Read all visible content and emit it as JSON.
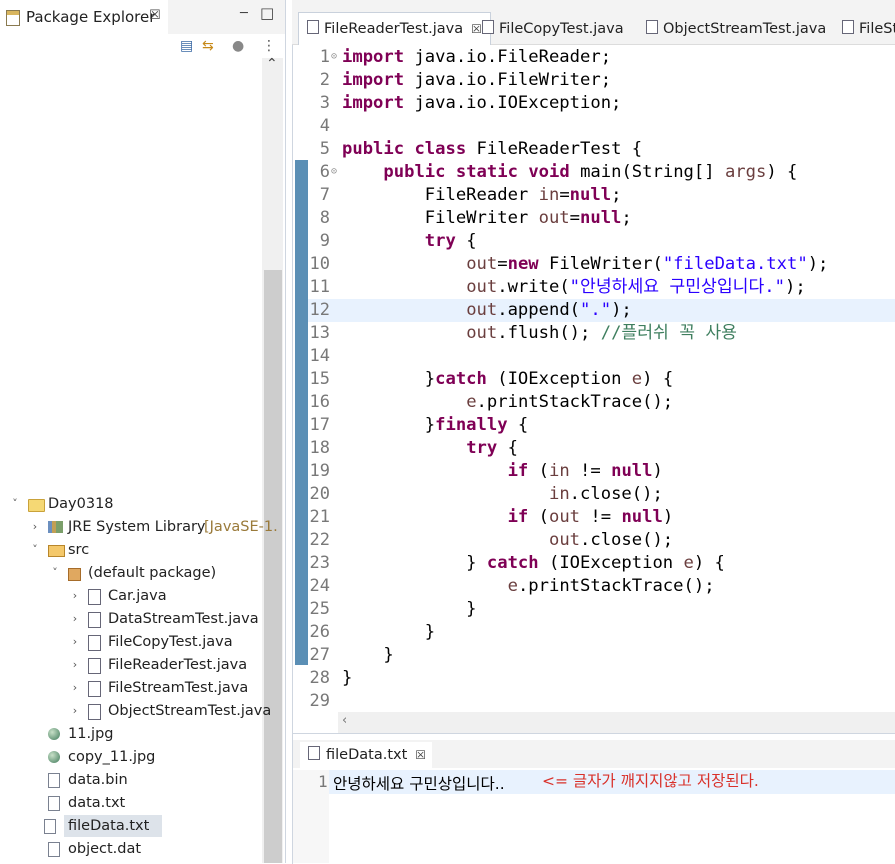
{
  "explorer": {
    "title": "Package Explorer",
    "close": "☒",
    "tree": [
      {
        "label": "Day0318",
        "icon": "project",
        "indent": 0,
        "twisty": "˅"
      },
      {
        "label": "JRE System Library",
        "suffix": "[JavaSE-1.",
        "icon": "library",
        "indent": 1,
        "twisty": "›"
      },
      {
        "label": "src",
        "icon": "source-folder",
        "indent": 1,
        "twisty": "˅"
      },
      {
        "label": "(default package)",
        "icon": "package",
        "indent": 2,
        "twisty": "˅"
      },
      {
        "label": "Car.java",
        "icon": "java",
        "indent": 3,
        "twisty": "›"
      },
      {
        "label": "DataStreamTest.java",
        "icon": "java",
        "indent": 3,
        "twisty": "›"
      },
      {
        "label": "FileCopyTest.java",
        "icon": "java",
        "indent": 3,
        "twisty": "›"
      },
      {
        "label": "FileReaderTest.java",
        "icon": "java",
        "indent": 3,
        "twisty": "›"
      },
      {
        "label": "FileStreamTest.java",
        "icon": "java",
        "indent": 3,
        "twisty": "›"
      },
      {
        "label": "ObjectStreamTest.java",
        "icon": "java",
        "indent": 3,
        "twisty": "›"
      },
      {
        "label": "11.jpg",
        "icon": "image",
        "indent": 1,
        "twisty": ""
      },
      {
        "label": "copy_11.jpg",
        "icon": "image",
        "indent": 1,
        "twisty": ""
      },
      {
        "label": "data.bin",
        "icon": "file",
        "indent": 1,
        "twisty": ""
      },
      {
        "label": "data.txt",
        "icon": "file",
        "indent": 1,
        "twisty": ""
      },
      {
        "label": "fileData.txt",
        "icon": "file",
        "indent": 1,
        "twisty": "",
        "selected": true
      },
      {
        "label": "object.dat",
        "icon": "file",
        "indent": 1,
        "twisty": ""
      }
    ]
  },
  "editor": {
    "tabs": [
      {
        "label": "FileReaderTest.java",
        "active": true,
        "close": "☒"
      },
      {
        "label": "FileCopyTest.java"
      },
      {
        "label": "ObjectStreamTest.java"
      },
      {
        "label": "FileStr"
      }
    ],
    "lines": [
      {
        "n": "1",
        "fold": "⊝",
        "t": [
          [
            "import",
            "kw"
          ],
          [
            " java.io.FileReader;",
            ""
          ]
        ]
      },
      {
        "n": "2",
        "t": [
          [
            "import",
            "kw"
          ],
          [
            " java.io.FileWriter;",
            ""
          ]
        ]
      },
      {
        "n": "3",
        "t": [
          [
            "import",
            "kw"
          ],
          [
            " java.io.IOException;",
            ""
          ]
        ]
      },
      {
        "n": "4",
        "t": []
      },
      {
        "n": "5",
        "t": [
          [
            "public",
            "kw"
          ],
          [
            " ",
            ""
          ],
          [
            "class",
            "kw"
          ],
          [
            " FileReaderTest {",
            ""
          ]
        ]
      },
      {
        "n": "6",
        "fold": "⊝",
        "t": [
          [
            "    ",
            ""
          ],
          [
            "public",
            "kw"
          ],
          [
            " ",
            ""
          ],
          [
            "static",
            "kw"
          ],
          [
            " ",
            ""
          ],
          [
            "void",
            "kw"
          ],
          [
            " main(String[] ",
            ""
          ],
          [
            "args",
            "var"
          ],
          [
            ") {",
            ""
          ]
        ]
      },
      {
        "n": "7",
        "t": [
          [
            "        FileReader ",
            ""
          ],
          [
            "in",
            "var"
          ],
          [
            "=",
            ""
          ],
          [
            "null",
            "kw"
          ],
          [
            ";",
            ""
          ]
        ]
      },
      {
        "n": "8",
        "t": [
          [
            "        FileWriter ",
            ""
          ],
          [
            "out",
            "var"
          ],
          [
            "=",
            ""
          ],
          [
            "null",
            "kw"
          ],
          [
            ";",
            ""
          ]
        ]
      },
      {
        "n": "9",
        "t": [
          [
            "        ",
            ""
          ],
          [
            "try",
            "kw"
          ],
          [
            " {",
            ""
          ]
        ]
      },
      {
        "n": "10",
        "t": [
          [
            "            ",
            ""
          ],
          [
            "out",
            "var"
          ],
          [
            "=",
            ""
          ],
          [
            "new",
            "kw"
          ],
          [
            " FileWriter(",
            ""
          ],
          [
            "\"fileData.txt\"",
            "str"
          ],
          [
            ");",
            ""
          ]
        ]
      },
      {
        "n": "11",
        "t": [
          [
            "            ",
            ""
          ],
          [
            "out",
            "var"
          ],
          [
            ".write(",
            ""
          ],
          [
            "\"안녕하세요 구민상입니다.\"",
            "str"
          ],
          [
            ");",
            ""
          ]
        ]
      },
      {
        "n": "12",
        "current": true,
        "t": [
          [
            "            ",
            ""
          ],
          [
            "out",
            "var"
          ],
          [
            ".append(",
            ""
          ],
          [
            "\".\"",
            "str"
          ],
          [
            ");",
            ""
          ]
        ]
      },
      {
        "n": "13",
        "t": [
          [
            "            ",
            ""
          ],
          [
            "out",
            "var"
          ],
          [
            ".flush(); ",
            ""
          ],
          [
            "//플러쉬 꼭 사용",
            "cmt"
          ]
        ]
      },
      {
        "n": "14",
        "t": []
      },
      {
        "n": "15",
        "t": [
          [
            "        }",
            ""
          ],
          [
            "catch",
            "kw"
          ],
          [
            " (IOException ",
            ""
          ],
          [
            "e",
            "var"
          ],
          [
            ") {",
            ""
          ]
        ]
      },
      {
        "n": "16",
        "t": [
          [
            "            ",
            ""
          ],
          [
            "e",
            "var"
          ],
          [
            ".printStackTrace();",
            ""
          ]
        ]
      },
      {
        "n": "17",
        "t": [
          [
            "        }",
            ""
          ],
          [
            "finally",
            "kw"
          ],
          [
            " {",
            ""
          ]
        ]
      },
      {
        "n": "18",
        "t": [
          [
            "            ",
            ""
          ],
          [
            "try",
            "kw"
          ],
          [
            " {",
            ""
          ]
        ]
      },
      {
        "n": "19",
        "t": [
          [
            "                ",
            ""
          ],
          [
            "if",
            "kw"
          ],
          [
            " (",
            ""
          ],
          [
            "in",
            "var"
          ],
          [
            " != ",
            ""
          ],
          [
            "null",
            "kw"
          ],
          [
            ")",
            ""
          ]
        ]
      },
      {
        "n": "20",
        "t": [
          [
            "                    ",
            ""
          ],
          [
            "in",
            "var"
          ],
          [
            ".close();",
            ""
          ]
        ]
      },
      {
        "n": "21",
        "t": [
          [
            "                ",
            ""
          ],
          [
            "if",
            "kw"
          ],
          [
            " (",
            ""
          ],
          [
            "out",
            "var"
          ],
          [
            " != ",
            ""
          ],
          [
            "null",
            "kw"
          ],
          [
            ")",
            ""
          ]
        ]
      },
      {
        "n": "22",
        "t": [
          [
            "                    ",
            ""
          ],
          [
            "out",
            "var"
          ],
          [
            ".close();",
            ""
          ]
        ]
      },
      {
        "n": "23",
        "t": [
          [
            "            } ",
            ""
          ],
          [
            "catch",
            "kw"
          ],
          [
            " (IOException ",
            ""
          ],
          [
            "e",
            "var"
          ],
          [
            ") {",
            ""
          ]
        ]
      },
      {
        "n": "24",
        "t": [
          [
            "                ",
            ""
          ],
          [
            "e",
            "var"
          ],
          [
            ".printStackTrace();",
            ""
          ]
        ]
      },
      {
        "n": "25",
        "t": [
          [
            "            }",
            ""
          ]
        ]
      },
      {
        "n": "26",
        "t": [
          [
            "        }",
            ""
          ]
        ]
      },
      {
        "n": "27",
        "t": [
          [
            "    }",
            ""
          ]
        ]
      },
      {
        "n": "28",
        "t": [
          [
            "}",
            ""
          ]
        ]
      },
      {
        "n": "29",
        "t": []
      }
    ]
  },
  "bottom": {
    "tab_label": "fileData.txt",
    "tab_close": "☒",
    "line_number": "1",
    "content": "안녕하세요 구민상입니다..",
    "annotation": "<= 글자가 깨지지않고 저장된다."
  },
  "colors": {
    "keyword": "#7f0055",
    "string": "#2a00ff",
    "variable": "#6a3e3e",
    "comment": "#3f7f5f",
    "annotation": "#d9312a",
    "ruler": "#5b8fb5"
  }
}
